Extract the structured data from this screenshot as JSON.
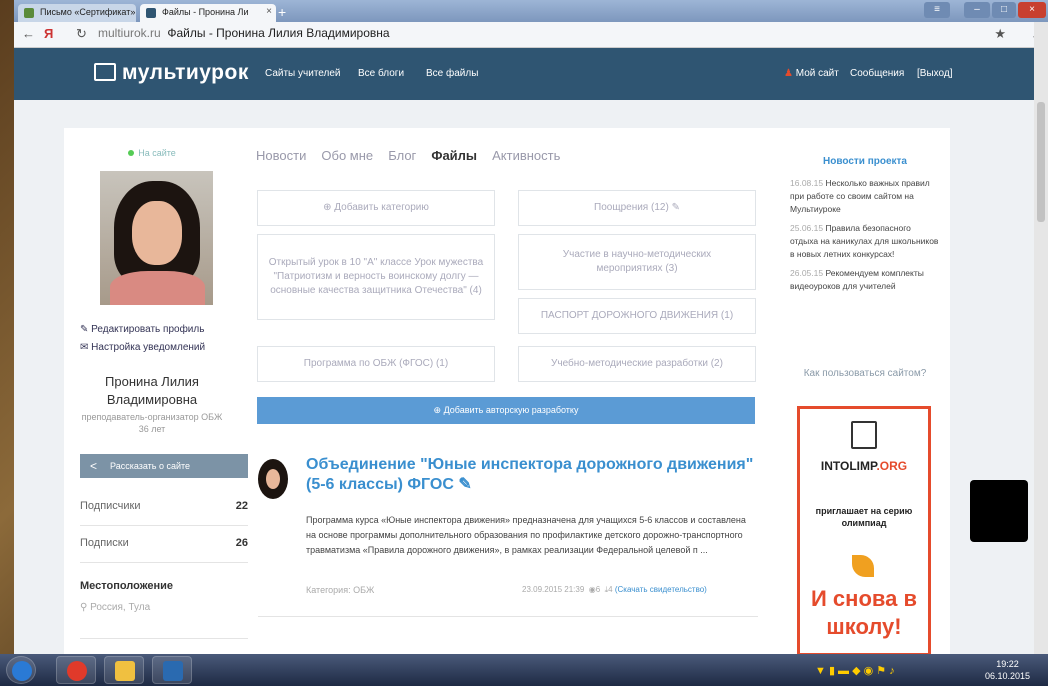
{
  "browser": {
    "tabs": [
      {
        "label": "Письмо «Сертификат»",
        "active": false
      },
      {
        "label": "Файлы - Пронина Ли",
        "active": true
      }
    ],
    "url_domain": "multiurok.ru",
    "url_title": "Файлы - Пронина Лилия Владимировна"
  },
  "site": {
    "logo": "мультиурок",
    "nav": [
      "Сайты учителей",
      "Все блоги",
      "Все файлы"
    ],
    "nav_right": [
      "Мой сайт",
      "Сообщения",
      "[Выход]"
    ],
    "brand_color": "#2f5572",
    "accent_color": "#3a8fcf"
  },
  "profile": {
    "status": "На сайте",
    "edit_profile": "Редактировать профиль",
    "notify_settings": "Настройка уведомлений",
    "name": "Пронина Лилия Владимировна",
    "title": "преподаватель-организатор ОБЖ",
    "age": "36 лет",
    "share_label": "Рассказать о сайте",
    "subscribers_label": "Подписчики",
    "subscribers_count": "22",
    "subscriptions_label": "Подписки",
    "subscriptions_count": "26",
    "location_heading": "Местоположение",
    "location_value": "Россия, Тула"
  },
  "tabs": [
    "Новости",
    "Обо мне",
    "Блог",
    "Файлы",
    "Активность"
  ],
  "active_tab": "Файлы",
  "categories": {
    "add_category": "Добавить категорию",
    "awards": "Поощрения (12)",
    "open_lesson": "Открытый урок в 10 \"А\" классе Урок мужества \"Патриотизм и верность воинскому долгу — основные качества защитника Отечества\" (4)",
    "science_events": "Участие в научно-методических мероприятиях (3)",
    "road_passport": "ПАСПОРТ ДОРОЖНОГО ДВИЖЕНИЯ (1)",
    "obzh_program": "Программа по ОБЖ (ФГОС) (1)",
    "methodical": "Учебно-методические разработки (2)"
  },
  "add_dev_button": "Добавить авторскую разработку",
  "post": {
    "title": "Объединение \"Юные инспектора дорожного движения\" (5-6 классы) ФГОС",
    "body": "Программа курса «Юные инспектора движения» предназначена для учащихся 5-6 классов и составлена на основе программы дополнительного образования по профилактике детского дорожно-транспортного травматизма «Правила дорожного движения», в рамках реализации Федеральной целевой п ...",
    "category": "Категория: ОБЖ",
    "date": "23.09.2015 21:39",
    "views": "6",
    "downloads": "4",
    "cert": "(Скачать свидетельство)"
  },
  "news": {
    "heading": "Новости проекта",
    "items": [
      {
        "date": "16.08.15",
        "text": "Несколько важных правил при работе со своим сайтом на Мультиуроке"
      },
      {
        "date": "25.06.15",
        "text": "Правила безопасного отдыха на каникулах для школьников в новых летних конкурсах!"
      },
      {
        "date": "26.05.15",
        "text": "Рекомендуем комплекты видеоуроков для учителей"
      }
    ],
    "howto": "Как пользоваться сайтом?"
  },
  "ad": {
    "logo_a": "INTOLIMP",
    "logo_b": ".ORG",
    "sub": "приглашает на серию олимпиад",
    "big": "И снова в школу!"
  },
  "taskbar": {
    "time": "19:22",
    "date": "06.10.2015"
  }
}
